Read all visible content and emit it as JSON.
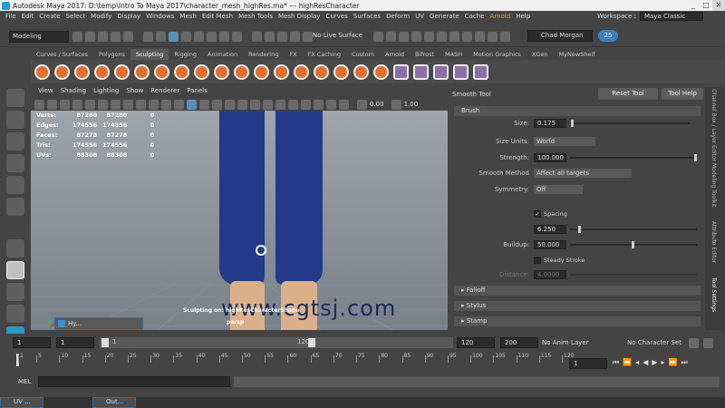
{
  "title": {
    "text": "Autodesk Maya 2017: D:\\temp\\Intro To Maya 2017\\character_mesh_highRes.ma*   ---   highResCharacter",
    "controls": [
      "_",
      "□",
      "✕"
    ]
  },
  "menubar": {
    "items": [
      "File",
      "Edit",
      "Create",
      "Select",
      "Modify",
      "Display",
      "Windows",
      "Mesh",
      "Edit Mesh",
      "Mesh Tools",
      "Mesh Display",
      "Curves",
      "Surfaces",
      "Deform",
      "UV",
      "Generate",
      "Cache"
    ],
    "arnold": "Arnold",
    "help": "Help",
    "workspace_label": "Workspace :",
    "workspace_value": "Maya Classic"
  },
  "statusline": {
    "mode": "Modeling",
    "live_surface": "No Live Surface",
    "user": "Chad Morgan",
    "count": "25"
  },
  "shelf": {
    "tabs": [
      "Curves / Surfaces",
      "Polygons",
      "Sculpting",
      "Rigging",
      "Animation",
      "Rendering",
      "FX",
      "FX Caching",
      "Custom",
      "Arnold",
      "Bifrost",
      "MASH",
      "Motion Graphics",
      "XGen",
      "MyNewShelf"
    ],
    "active_tab": "Sculpting"
  },
  "panel": {
    "menu": [
      "View",
      "Shading",
      "Lighting",
      "Show",
      "Renderer",
      "Panels"
    ],
    "exposure": "0.00",
    "gamma": "1.00"
  },
  "hud": {
    "rows": [
      {
        "label": "Verts:",
        "a": "87280",
        "b": "87280",
        "c": "0"
      },
      {
        "label": "Edges:",
        "a": "174556",
        "b": "174556",
        "c": "0"
      },
      {
        "label": "Faces:",
        "a": "87278",
        "b": "87278",
        "c": "0"
      },
      {
        "label": "Tris:",
        "a": "174556",
        "b": "174556",
        "c": "0"
      },
      {
        "label": "UVs:",
        "a": "88308",
        "b": "88308",
        "c": "0"
      }
    ]
  },
  "viewport": {
    "watermark": "www.cgtsj.com",
    "sculpt_info": "Sculpting on: highResCharacterShape",
    "camera": "persp",
    "mini_window": "Hy..."
  },
  "tool_settings": {
    "title": "Smooth Tool",
    "reset": "Reset Tool",
    "help": "Tool Help",
    "brush_section": "Brush",
    "size_label": "Size:",
    "size": "0.175",
    "size_units_label": "Size Units:",
    "size_units": "World",
    "strength_label": "Strength:",
    "strength": "100.000",
    "smooth_method_label": "Smooth Method",
    "smooth_method": "Affect all targets",
    "symmetry_label": "Symmetry:",
    "symmetry": "Off",
    "spacing_label": "Spacing",
    "spacing": "6.250",
    "buildup_label": "Buildup:",
    "buildup": "50.000",
    "steady_label": "Steady Stroke",
    "distance_label": "Distance:",
    "distance": "4.0000",
    "sections": [
      "Falloff",
      "Stylus",
      "Stamp"
    ]
  },
  "sidetabs": [
    "Attribute Editor",
    "Modeling Toolkit",
    "Attribute Editor",
    "Tool Settings",
    "Channel Box / Layer Editor"
  ],
  "range": {
    "start": "1",
    "anim_start": "1",
    "slider_start": "1",
    "slider_end": "120",
    "anim_end": "120",
    "end": "200",
    "anim_layer": "No Anim Layer",
    "character_set": "No Character Set"
  },
  "timeline": {
    "ticks": [
      "1",
      "5",
      "10",
      "15",
      "20",
      "25",
      "30",
      "35",
      "40",
      "45",
      "50",
      "55",
      "60",
      "65",
      "70",
      "75",
      "80",
      "85",
      "90",
      "95",
      "100",
      "105",
      "110",
      "115",
      "120"
    ],
    "current": "1"
  },
  "melbar": {
    "label": "MEL"
  },
  "taskbar": {
    "items": [
      "UV ...",
      "Out..."
    ]
  }
}
